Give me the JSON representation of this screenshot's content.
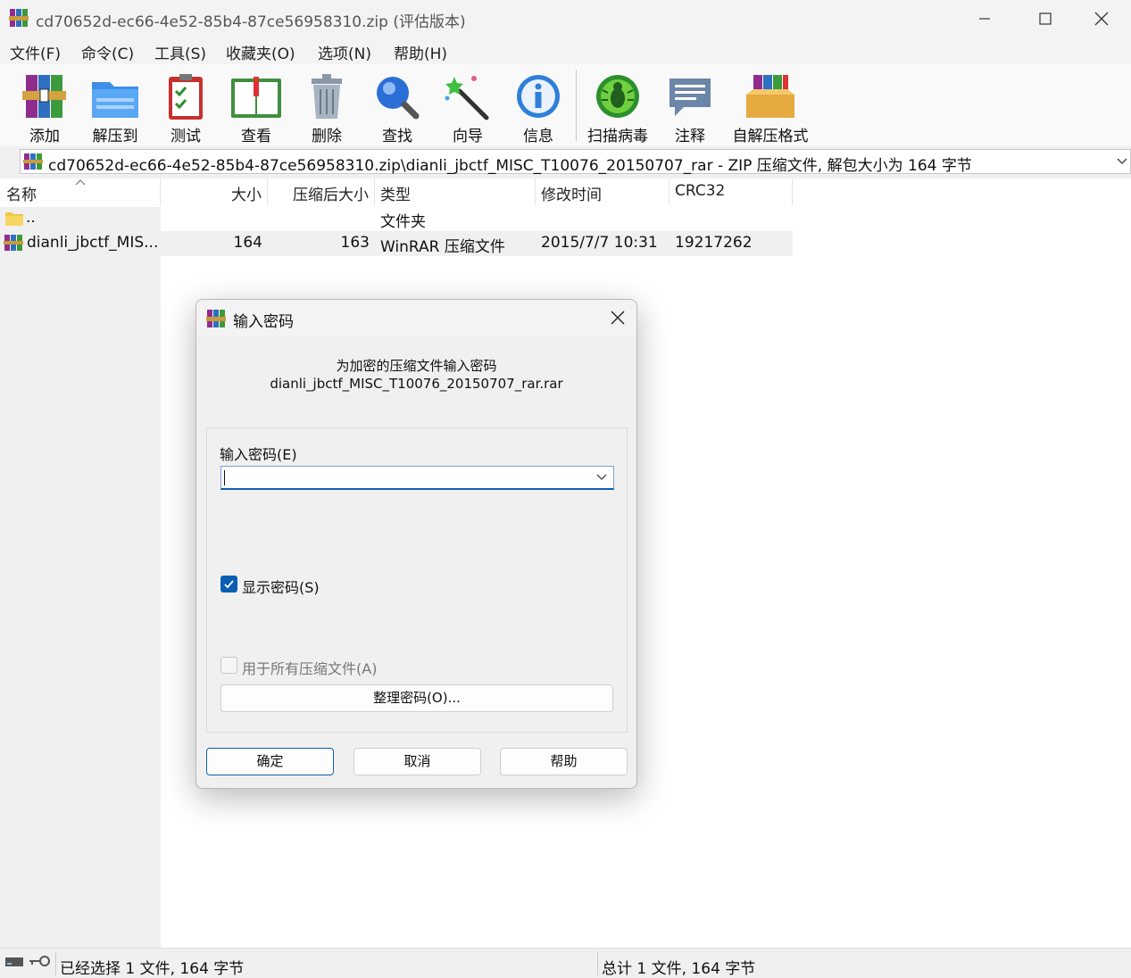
{
  "window": {
    "title": "cd70652d-ec66-4e52-85b4-87ce56958310.zip (评估版本)"
  },
  "menu": [
    "文件(F)",
    "命令(C)",
    "工具(S)",
    "收藏夹(O)",
    "选项(N)",
    "帮助(H)"
  ],
  "toolbar": {
    "buttons": [
      {
        "label": "添加",
        "icon": "books-add-icon"
      },
      {
        "label": "解压到",
        "icon": "folder-extract-icon"
      },
      {
        "label": "测试",
        "icon": "clipboard-test-icon"
      },
      {
        "label": "查看",
        "icon": "open-book-icon"
      },
      {
        "label": "删除",
        "icon": "trash-can-icon"
      },
      {
        "label": "查找",
        "icon": "magnifier-icon"
      },
      {
        "label": "向导",
        "icon": "magic-wand-icon"
      },
      {
        "label": "信息",
        "icon": "info-icon"
      },
      {
        "label": "扫描病毒",
        "icon": "bug-scan-icon"
      },
      {
        "label": "注释",
        "icon": "comment-icon"
      },
      {
        "label": "自解压格式",
        "icon": "sfx-box-icon"
      }
    ]
  },
  "address": {
    "path": "cd70652d-ec66-4e52-85b4-87ce56958310.zip\\dianli_jbctf_MISC_T10076_20150707_rar - ZIP 压缩文件, 解包大小为 164 字节"
  },
  "columns": [
    "名称",
    "大小",
    "压缩后大小",
    "类型",
    "修改时间",
    "CRC32"
  ],
  "files": [
    {
      "name": "..",
      "size": "",
      "packed": "",
      "type": "文件夹",
      "modified": "",
      "crc": ""
    },
    {
      "name": "dianli_jbctf_MIS...",
      "size": "164",
      "packed": "163",
      "type": "WinRAR 压缩文件",
      "modified": "2015/7/7 10:31",
      "crc": "19217262"
    }
  ],
  "status": {
    "left": "已经选择 1 文件, 164 字节",
    "right": "总计 1 文件, 164 字节"
  },
  "dialog": {
    "title": "输入密码",
    "message": "为加密的压缩文件输入密码",
    "filename": "dianli_jbctf_MISC_T10076_20150707_rar.rar",
    "password_label": "输入密码(E)",
    "password_value": "",
    "show_password_label": "显示密码(S)",
    "show_password_checked": true,
    "use_all_label": "用于所有压缩文件(A)",
    "use_all_checked": false,
    "organize_label": "整理密码(O)...",
    "ok_label": "确定",
    "cancel_label": "取消",
    "help_label": "帮助"
  },
  "colors": {
    "accent": "#0a5fb4",
    "selected_row": "#f0f0f0"
  }
}
